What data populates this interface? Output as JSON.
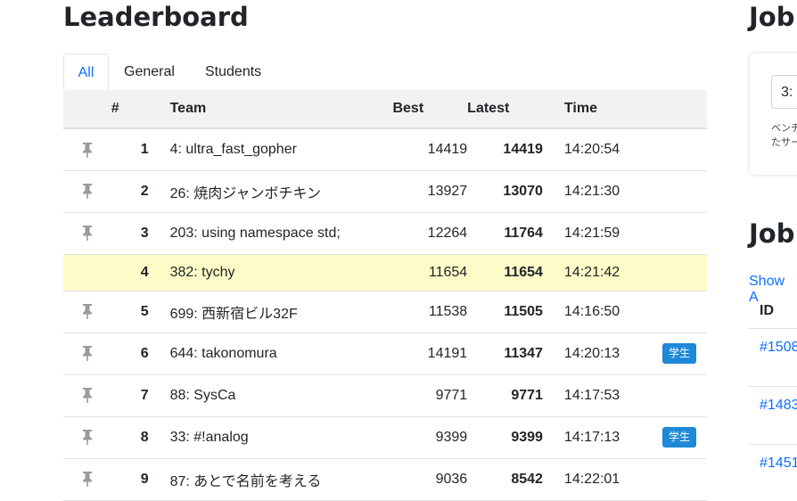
{
  "leaderboard": {
    "title": "Leaderboard",
    "tabs": [
      {
        "label": "All",
        "active": true
      },
      {
        "label": "General",
        "active": false
      },
      {
        "label": "Students",
        "active": false
      }
    ],
    "columns": {
      "rank": "#",
      "team": "Team",
      "best": "Best",
      "latest": "Latest",
      "time": "Time"
    },
    "rows": [
      {
        "rank": "1",
        "team": "4: ultra_fast_gopher",
        "best": "14419",
        "latest": "14419",
        "time": "14:20:54",
        "badge": "",
        "highlight": false
      },
      {
        "rank": "2",
        "team": "26: 焼肉ジャンボチキン",
        "best": "13927",
        "latest": "13070",
        "time": "14:21:30",
        "badge": "",
        "highlight": false
      },
      {
        "rank": "3",
        "team": "203: using namespace std;",
        "best": "12264",
        "latest": "11764",
        "time": "14:21:59",
        "badge": "",
        "highlight": false
      },
      {
        "rank": "4",
        "team": "382: tychy",
        "best": "11654",
        "latest": "11654",
        "time": "14:21:42",
        "badge": "",
        "highlight": true
      },
      {
        "rank": "5",
        "team": "699: 西新宿ビル32F",
        "best": "11538",
        "latest": "11505",
        "time": "14:16:50",
        "badge": "",
        "highlight": false
      },
      {
        "rank": "6",
        "team": "644: takonomura",
        "best": "14191",
        "latest": "11347",
        "time": "14:20:13",
        "badge": "学生",
        "highlight": false
      },
      {
        "rank": "7",
        "team": "88: SysCa",
        "best": "9771",
        "latest": "9771",
        "time": "14:17:53",
        "badge": "",
        "highlight": false
      },
      {
        "rank": "8",
        "team": "33: #!analog",
        "best": "9399",
        "latest": "9399",
        "time": "14:17:13",
        "badge": "学生",
        "highlight": false
      },
      {
        "rank": "9",
        "team": "87: あとで名前を考える",
        "best": "9036",
        "latest": "8542",
        "time": "14:22:01",
        "badge": "",
        "highlight": false
      }
    ]
  },
  "right_panel": {
    "title1": "Job",
    "select_value": "3:",
    "note_line1": "ベンチ",
    "note_line2": "たサー",
    "title2": "Job",
    "show_all": "Show A",
    "id_header": "ID",
    "job_ids": [
      "#1508",
      "#1483",
      "#1451"
    ]
  },
  "colors": {
    "accent": "#0d6efd",
    "highlight_row": "#fdfbc7",
    "badge": "#1e88d9"
  }
}
